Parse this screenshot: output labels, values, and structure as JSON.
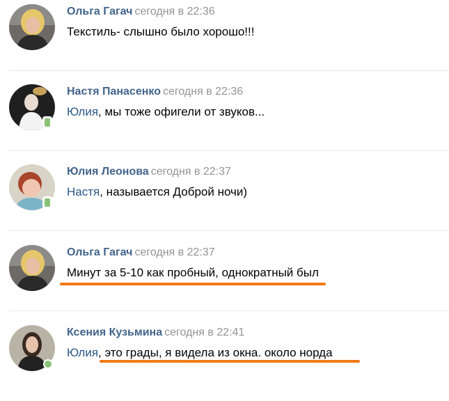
{
  "comments": [
    {
      "author": "Ольга Гагач",
      "time": "сегодня в 22:36",
      "mention": "",
      "text": "Текстиль- слышно было хорошо!!!",
      "avatar_icon": "user-photo-olga",
      "status": "none",
      "highlighted": false
    },
    {
      "author": "Настя Панасенко",
      "time": "сегодня в 22:36",
      "mention": "Юлия",
      "text": ", мы тоже офигели от звуков...",
      "avatar_icon": "user-photo-nastya",
      "status": "mobile",
      "highlighted": false
    },
    {
      "author": "Юлия Леонова",
      "time": "сегодня в 22:37",
      "mention": "Настя",
      "text": ", называется Доброй ночи)",
      "avatar_icon": "user-photo-yulia",
      "status": "mobile",
      "highlighted": false
    },
    {
      "author": "Ольга Гагач",
      "time": "сегодня в 22:37",
      "mention": "",
      "text": "Минут за 5-10 как пробный, однократный был",
      "avatar_icon": "user-photo-olga",
      "status": "none",
      "highlighted": true
    },
    {
      "author": "Ксения Кузьмина",
      "time": "сегодня в 22:41",
      "mention": "Юлия",
      "text": ", это грады, я видела из окна. около норда",
      "avatar_icon": "user-photo-kseniya",
      "status": "online",
      "highlighted": true
    }
  ],
  "colors": {
    "author": "#42648b",
    "mention": "#2a5885",
    "time": "#939393",
    "highlight": "#f07a17",
    "online": "#8ac176"
  }
}
